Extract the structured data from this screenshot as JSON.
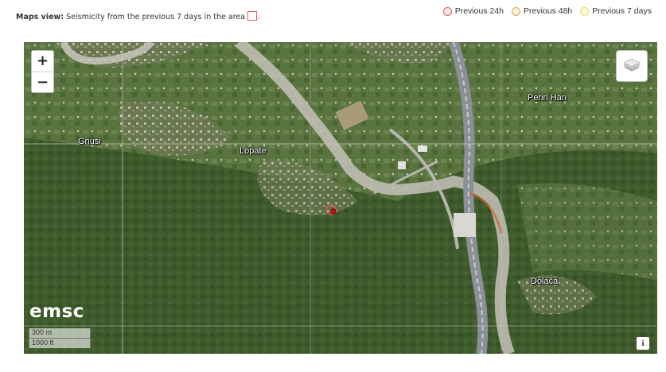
{
  "caption": {
    "prefix": "Maps view:",
    "text": "Seismicity from the previous 7 days in the area",
    "suffix": "."
  },
  "legend": [
    {
      "label": "Previous 24h",
      "color": "#e05a5a"
    },
    {
      "label": "Previous 48h",
      "color": "#e2a250"
    },
    {
      "label": "Previous 7 days",
      "color": "#e6df6a"
    }
  ],
  "map": {
    "zoom_in_label": "+",
    "zoom_out_label": "−",
    "layers_icon": "layers-icon",
    "places": {
      "perin_han": "Perin Han",
      "gnusi": "Gnusi",
      "lopate": "Lopate",
      "dolaca": "Dolača"
    },
    "logo": "emsc",
    "scale": {
      "metric": "300 m",
      "imperial": "1000 ft"
    },
    "attribution_label": "i",
    "event_marker_color": "#cc1111"
  }
}
